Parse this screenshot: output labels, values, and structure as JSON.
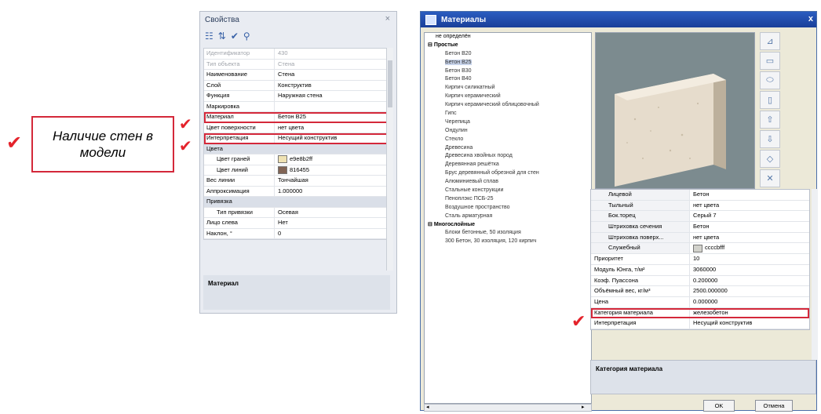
{
  "callout": {
    "text": "Наличие стен в модели"
  },
  "check_mark": "✔",
  "properties": {
    "title": "Свойства",
    "close": "×",
    "rows": [
      {
        "key": "Идентификатор",
        "value": "430",
        "style": "dim"
      },
      {
        "key": "Тип объекта",
        "value": "Стена",
        "style": "dim"
      },
      {
        "key": "Наименование",
        "value": "Стена"
      },
      {
        "key": "Слой",
        "value": "Конструктив"
      },
      {
        "key": "Функция",
        "value": "Наружная стена"
      },
      {
        "key": "Маркировка",
        "value": ""
      },
      {
        "key": "Материал",
        "value": "Бетон В25",
        "highlight": true
      },
      {
        "key": "Цвет поверхности",
        "value": "нет цвета"
      },
      {
        "key": "Интерпретация",
        "value": "Несущий конструктив",
        "highlight": true
      },
      {
        "key": "Цвета",
        "value": "",
        "style": "group"
      },
      {
        "key": "Цвет граней",
        "value": "e9e8b2ff",
        "style": "sub",
        "swatch": "#efe2b3"
      },
      {
        "key": "Цвет линий",
        "value": "816455",
        "style": "sub",
        "swatch": "#816455"
      },
      {
        "key": "Вес линии",
        "value": "Тончайшая"
      },
      {
        "key": "Аппроксимация",
        "value": "1.000000"
      },
      {
        "key": "Привязка",
        "value": "",
        "style": "group"
      },
      {
        "key": "Тип привязки",
        "value": "Осевая",
        "style": "sub"
      },
      {
        "key": "Лицо слева",
        "value": "Нет"
      },
      {
        "key": "Наклон, °",
        "value": "0"
      }
    ],
    "description": "Материал"
  },
  "materials": {
    "title": "Материалы",
    "close": "x",
    "tree": [
      {
        "label": "не определён",
        "level": "l0"
      },
      {
        "label": "Простые",
        "level": "grp",
        "toggle": "⊟"
      },
      {
        "label": "Бетон В20",
        "level": "l1"
      },
      {
        "label": "Бетон В25",
        "level": "l1",
        "selected": true
      },
      {
        "label": "Бетон В30",
        "level": "l1"
      },
      {
        "label": "Бетон В40",
        "level": "l1"
      },
      {
        "label": "Кирпич силикатный",
        "level": "l1"
      },
      {
        "label": "Кирпич керамический",
        "level": "l1"
      },
      {
        "label": "Кирпич керамический облицовочный",
        "level": "l1"
      },
      {
        "label": "Гипс",
        "level": "l1"
      },
      {
        "label": "Черепица",
        "level": "l1"
      },
      {
        "label": "Ондулин",
        "level": "l1"
      },
      {
        "label": "Стекло",
        "level": "l1"
      },
      {
        "label": "Древесина",
        "level": "l1"
      },
      {
        "label": "Древесина хвойных пород",
        "level": "l1"
      },
      {
        "label": "Деревянная решётка",
        "level": "l1"
      },
      {
        "label": "Брус деревянный обрезной для стен",
        "level": "l1"
      },
      {
        "label": "Алюминиевый сплав",
        "level": "l1"
      },
      {
        "label": "Стальные конструкции",
        "level": "l1"
      },
      {
        "label": "Пеноплэкс ПСБ-25",
        "level": "l1"
      },
      {
        "label": "Воздушное пространство",
        "level": "l1"
      },
      {
        "label": "Сталь арматурная",
        "level": "l1"
      },
      {
        "label": "Многослойные",
        "level": "grp",
        "toggle": "⊟"
      },
      {
        "label": "Блоки бетонные, 50 изоляция",
        "level": "l1"
      },
      {
        "label": "300 Бетон, 30 изоляция, 120 кирпич",
        "level": "l1"
      }
    ],
    "tree_scroll": {
      "left": "◂",
      "right": "▸"
    },
    "toolbuttons": [
      {
        "glyph": "⊿",
        "name": "material-style-icon"
      },
      {
        "glyph": "▭",
        "name": "cube-view-icon"
      },
      {
        "glyph": "⬭",
        "name": "cylinder-flat-icon"
      },
      {
        "glyph": "▯",
        "name": "cylinder-upright-icon"
      },
      {
        "glyph": "⇧",
        "name": "arrow-up-icon"
      },
      {
        "glyph": "⇩",
        "name": "arrow-down-icon"
      },
      {
        "glyph": "◇",
        "name": "diamond-icon"
      },
      {
        "glyph": "✕",
        "name": "delete-icon"
      }
    ],
    "props": [
      {
        "key": "Лицевой",
        "value": "Бетон",
        "style": "sub"
      },
      {
        "key": "Тыльный",
        "value": "нет цвета",
        "style": "sub"
      },
      {
        "key": "Бок.торец",
        "value": "Серый 7",
        "style": "sub"
      },
      {
        "key": "Штриховка сечения",
        "value": "Бетон",
        "style": "sub"
      },
      {
        "key": "Штриховка поверх...",
        "value": "нет цвета",
        "style": "sub"
      },
      {
        "key": "Служебный",
        "value": "ccccbfff",
        "style": "sub",
        "swatch": "#d2d2cc"
      },
      {
        "key": "Приоритет",
        "value": "10"
      },
      {
        "key": "Модуль Юнга, т/м²",
        "value": "3060000"
      },
      {
        "key": "Коэф. Пуассона",
        "value": "0.200000"
      },
      {
        "key": "Объёмный вес, кг/м³",
        "value": "2500.000000"
      },
      {
        "key": "Цена",
        "value": "0.000000"
      },
      {
        "key": "Категория материала",
        "value": "железобетон",
        "highlight": true
      },
      {
        "key": "Интерпретация",
        "value": "Несущий конструктив"
      }
    ],
    "description": "Категория материала",
    "ok": "OK",
    "cancel": "Отмена"
  }
}
